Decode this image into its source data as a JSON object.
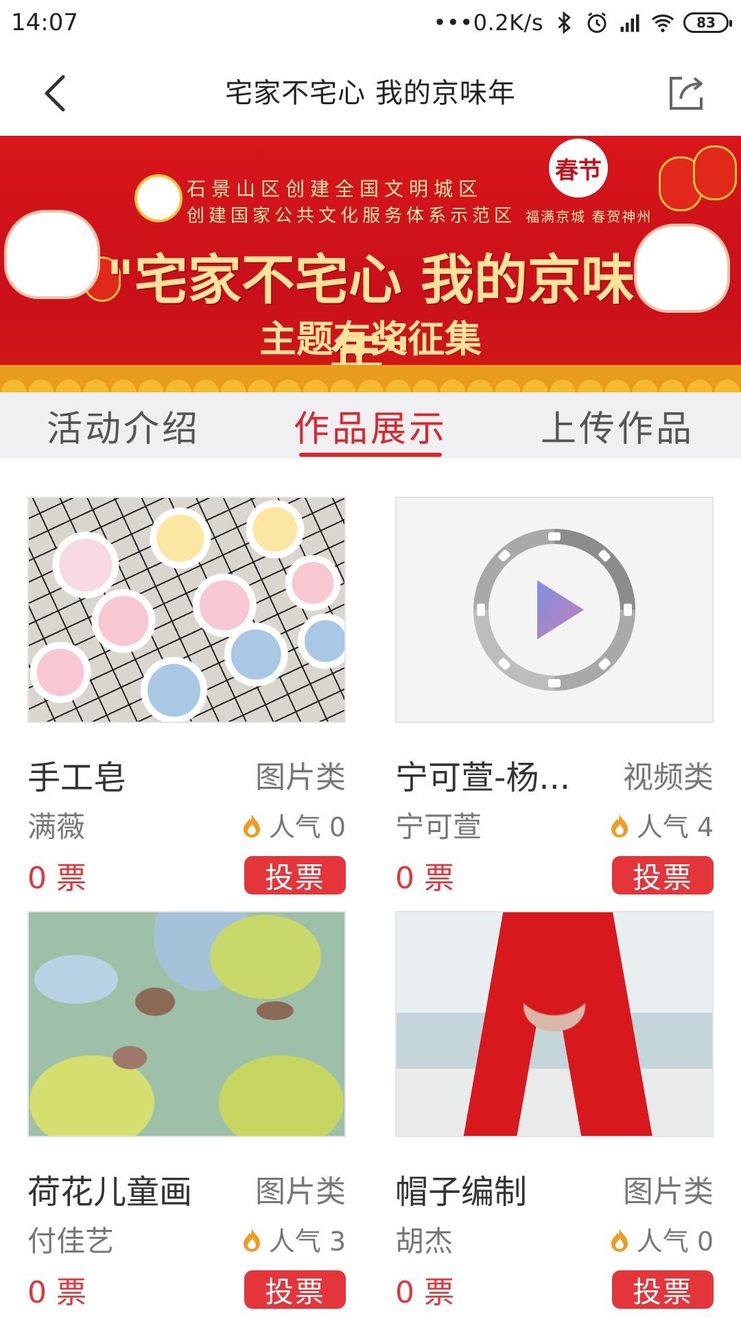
{
  "status_bar": {
    "time": "14:07",
    "network_speed": "0.2K/s",
    "battery": "83",
    "icons": [
      "dots-icon",
      "bluetooth-icon",
      "alarm-icon",
      "signal-icon",
      "wifi-icon",
      "battery-icon"
    ]
  },
  "nav": {
    "title": "宅家不宅心 我的京味年",
    "back_icon": "chevron-left-icon",
    "share_icon": "share-icon"
  },
  "banner": {
    "sub_line_1": "石景山区创建全国文明城区",
    "sub_line_2": "创建国家公共文化服务体系示范区",
    "main_title": "\"宅家不宅心 我的京味年\"",
    "theme": "主题有奖征集",
    "spring_badge": "春节",
    "blessing": "福满京城 春贺神州"
  },
  "tabs": [
    {
      "label": "活动介绍",
      "active": false
    },
    {
      "label": "作品展示",
      "active": true
    },
    {
      "label": "上传作品",
      "active": false
    }
  ],
  "works": [
    {
      "title": "手工皂",
      "category": "图片类",
      "author": "满薇",
      "popularity": "人气 0",
      "votes": "0 票",
      "vote_label": "投票",
      "thumb": "donuts"
    },
    {
      "title": "宁可萱-杨...",
      "category": "视频类",
      "author": "宁可萱",
      "popularity": "人气 4",
      "votes": "0 票",
      "vote_label": "投票",
      "thumb": "video"
    },
    {
      "title": "荷花儿童画",
      "category": "图片类",
      "author": "付佳艺",
      "popularity": "人气 3",
      "votes": "0 票",
      "vote_label": "投票",
      "thumb": "lotus"
    },
    {
      "title": "帽子编制",
      "category": "图片类",
      "author": "胡杰",
      "popularity": "人气 0",
      "votes": "0 票",
      "vote_label": "投票",
      "thumb": "hat"
    }
  ],
  "colors": {
    "accent": "#d8282b",
    "vote_button": "#e4353b",
    "flame": "#f39a1e",
    "banner_red": "#d8161a"
  }
}
